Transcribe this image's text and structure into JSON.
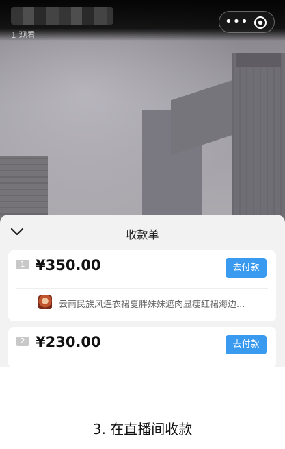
{
  "header": {
    "viewer_count": "1 观看",
    "more_icon": "ellipsis-icon",
    "close_icon": "target-close-icon"
  },
  "sheet": {
    "title": "收款单",
    "collapse_icon": "chevron-down-icon",
    "orders": [
      {
        "index": "1",
        "amount": "¥350.00",
        "pay_label": "去付款",
        "product": "云南民族风连衣裙夏胖妹妹遮肉显瘦红裙海边..."
      },
      {
        "index": "2",
        "amount": "¥230.00",
        "pay_label": "去付款"
      }
    ]
  },
  "caption": "3. 在直播间收款",
  "colors": {
    "accent": "#3a9af0",
    "sheet_bg": "#f2f2f2"
  }
}
